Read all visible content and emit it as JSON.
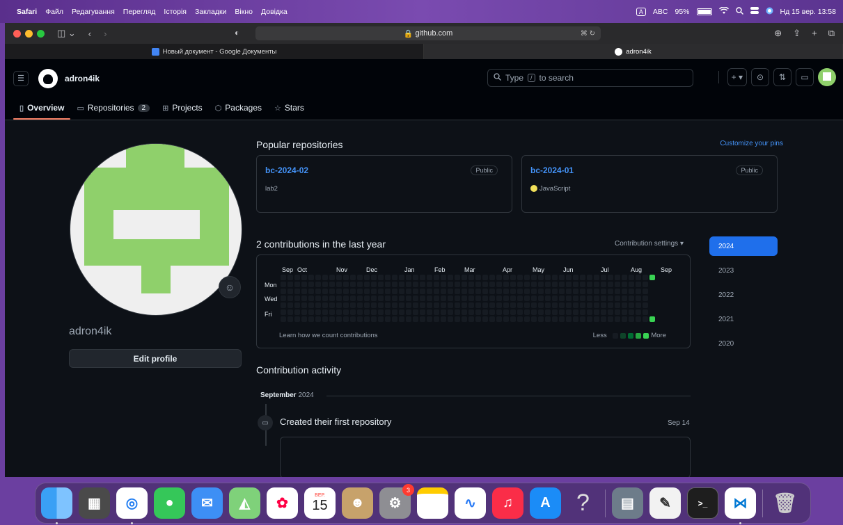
{
  "menubar": {
    "app": "Safari",
    "items": [
      "Файл",
      "Редагування",
      "Перегляд",
      "Історія",
      "Закладки",
      "Вікно",
      "Довідка"
    ],
    "input_source": "A",
    "input_label": "ABC",
    "battery": "95%",
    "datetime": "Нд 15 вер.  13:58"
  },
  "browser": {
    "url": "github.com",
    "tabs": [
      {
        "title": "Новый документ - Google Документы",
        "active": false
      },
      {
        "title": "adron4ik",
        "active": true
      }
    ]
  },
  "header": {
    "username": "adron4ik",
    "search_prefix": "Type",
    "search_key": "/",
    "search_suffix": "to search",
    "plus": "+"
  },
  "nav": {
    "overview": "Overview",
    "repositories": "Repositories",
    "repo_count": "2",
    "projects": "Projects",
    "packages": "Packages",
    "stars": "Stars"
  },
  "profile": {
    "login": "adron4ik",
    "edit": "Edit profile"
  },
  "popular": {
    "title": "Popular repositories",
    "customize": "Customize your pins",
    "repos": [
      {
        "name": "bc-2024-02",
        "visibility": "Public",
        "desc": "lab2"
      },
      {
        "name": "bc-2024-01",
        "visibility": "Public",
        "lang": "JavaScript"
      }
    ]
  },
  "contrib": {
    "title": "2 contributions in the last year",
    "settings": "Contribution settings ▾",
    "months": [
      "Sep",
      "Oct",
      "Nov",
      "Dec",
      "Jan",
      "Feb",
      "Mar",
      "Apr",
      "May",
      "Jun",
      "Jul",
      "Aug",
      "Sep"
    ],
    "days": [
      "Mon",
      "Wed",
      "Fri"
    ],
    "learn": "Learn how we count contributions",
    "less": "Less",
    "more": "More",
    "years": [
      "2024",
      "2023",
      "2022",
      "2021",
      "2020"
    ],
    "selected_year": "2024",
    "level_colors": [
      "#161b22",
      "#0e4429",
      "#006d32",
      "#26a641",
      "#39d353"
    ]
  },
  "activity": {
    "title": "Contribution activity",
    "month": "September",
    "year": "2024",
    "event": "Created their first repository",
    "date": "Sep 14"
  },
  "dock": {
    "calendar_month": "ВЕР.",
    "calendar_day": "15",
    "settings_badge": "3",
    "help": "?"
  }
}
